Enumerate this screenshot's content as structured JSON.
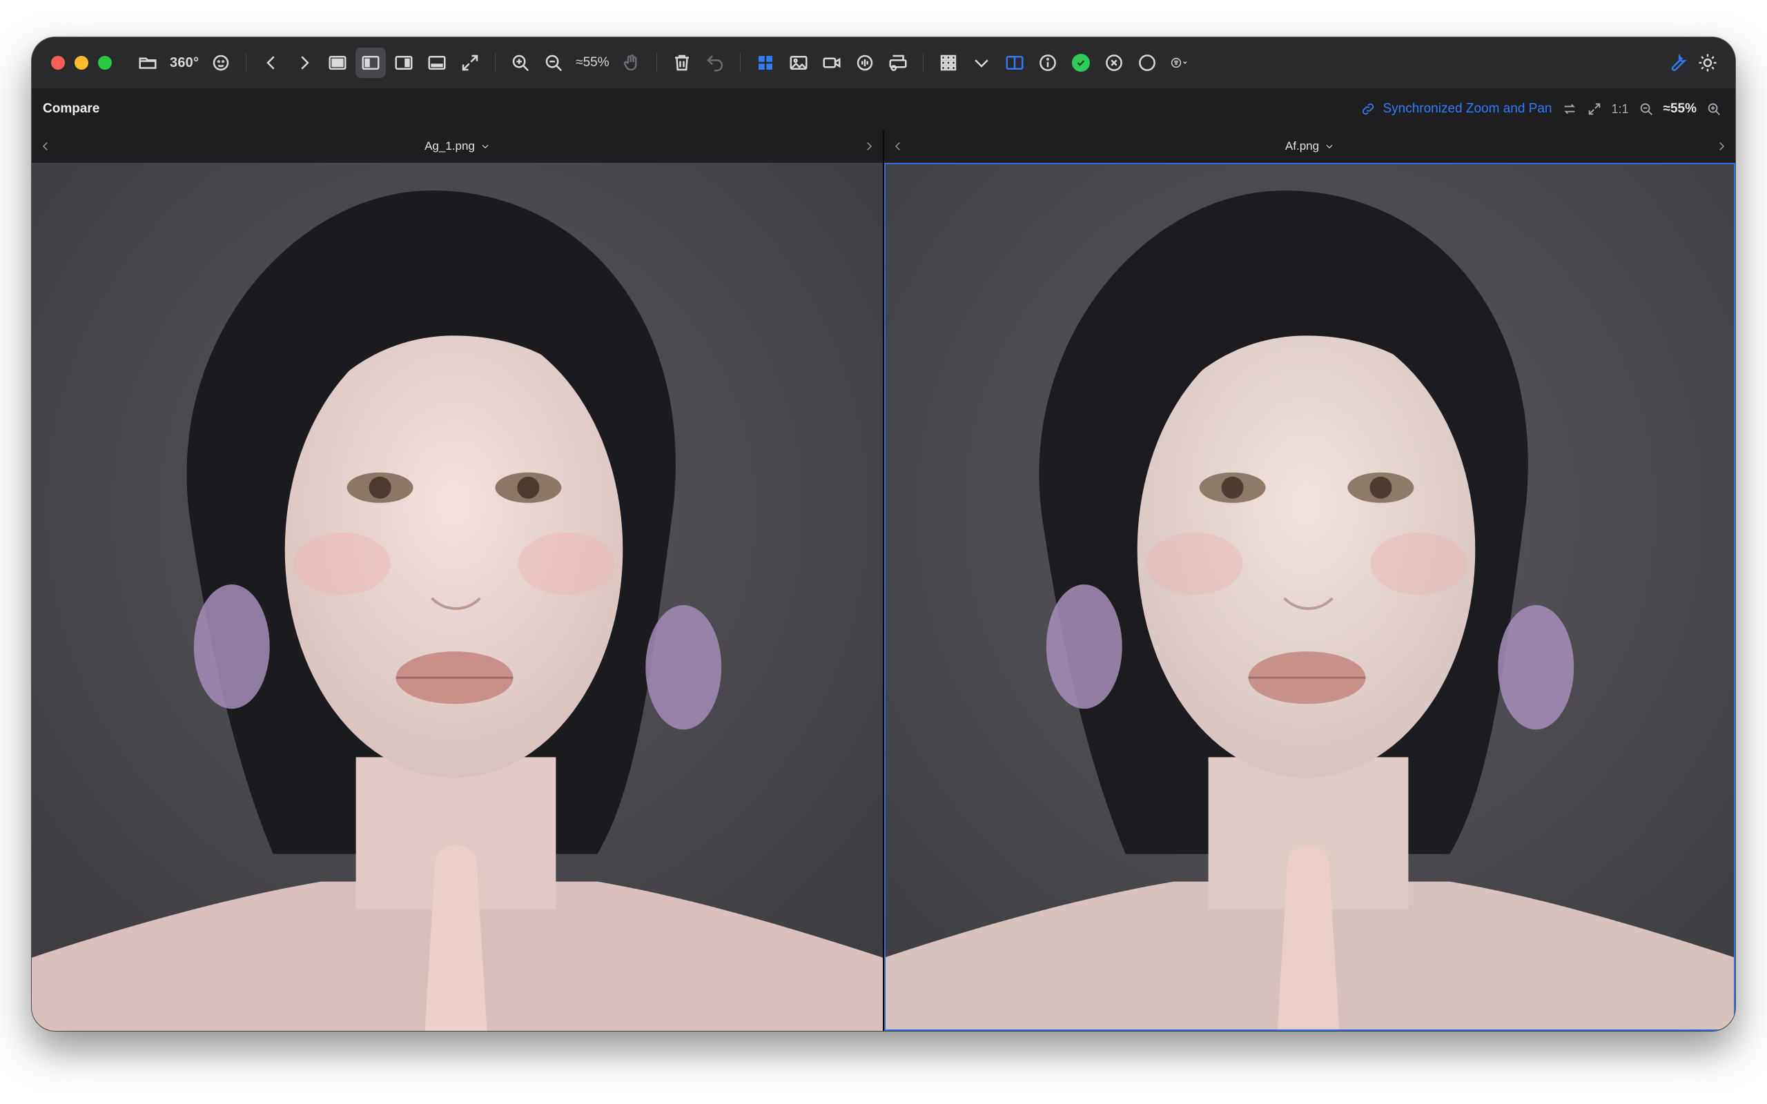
{
  "toolbar": {
    "rotate_label": "360°",
    "zoom_label": "≈55%"
  },
  "compare": {
    "title": "Compare",
    "sync_label": "Synchronized Zoom and Pan",
    "ratio_label": "1:1",
    "zoom_label": "≈55%"
  },
  "panes": [
    {
      "file_name": "Ag_1.png"
    },
    {
      "file_name": "Af.png"
    }
  ],
  "colors": {
    "accent": "#2f7cf6",
    "check": "#30c95a"
  }
}
